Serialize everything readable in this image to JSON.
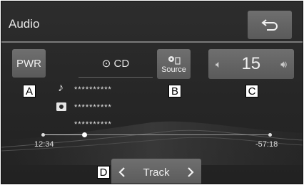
{
  "header": {
    "title": "Audio"
  },
  "controls": {
    "power_label": "PWR",
    "source_label": "Source",
    "volume_value": "15",
    "track_label": "Track"
  },
  "now_playing": {
    "source_name": "CD",
    "lines": [
      "**********",
      "**********",
      "**********"
    ]
  },
  "progress": {
    "elapsed": "12:34",
    "remaining": "-57:18",
    "fraction": 0.18
  },
  "callouts": [
    "A",
    "B",
    "C",
    "D"
  ],
  "colors": {
    "background": "#262626",
    "button": "#636363",
    "text": "#e6e6e6"
  }
}
